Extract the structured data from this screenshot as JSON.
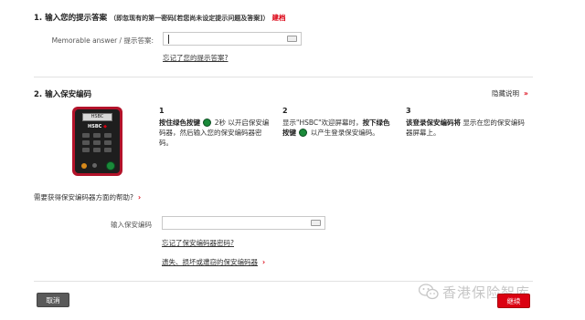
{
  "section1": {
    "title": "1. 输入您的提示答案",
    "note": "（即忽现有的第一密码[若您尚未设定提示问题及答案]）",
    "action_link": "建档",
    "field_label": "Memorable answer / 提示答案:",
    "field_value": "",
    "forgot_link": "忘记了您的提示答案?"
  },
  "section2": {
    "title": "2. 输入保安编码",
    "hide_link": "隐藏说明",
    "device": {
      "screen_text": "HSBC",
      "brand": "HSBC"
    },
    "steps": [
      {
        "number": "1",
        "bold_a": "按住绿色按键",
        "text_b": "2秒 以开启保安编码器，然后输入您的保安编码器密码。"
      },
      {
        "number": "2",
        "text_a": "显示\"HSBC\"欢迎屏幕时，",
        "bold_b": "按下绿色按键",
        "text_c": "以产生登录保安编码。"
      },
      {
        "number": "3",
        "bold_a": "该登录保安编码将",
        "text_b": "显示在您的保安编码器屏幕上。"
      }
    ],
    "help_link": "需要获得保安编码器方面的帮助?",
    "field_label": "输入保安编码",
    "field_value": "",
    "forgot_link": "忘记了保安编码器密码?",
    "lost_link": "遗失、损坏或遭窃的保安编码器"
  },
  "footer": {
    "cancel_label": "取消",
    "continue_label": "继续",
    "watermark": "香港保险智库"
  },
  "colors": {
    "brand_red": "#db0011",
    "button_grey": "#5a5a5a",
    "device_body": "#1e1e1e",
    "device_frame": "#b3132a",
    "green_key": "#1a8a3a"
  },
  "icons": [
    "keyboard-icon",
    "chevron-right-icon",
    "chevron-double-up-icon",
    "green-key-icon",
    "wechat-icon"
  ]
}
